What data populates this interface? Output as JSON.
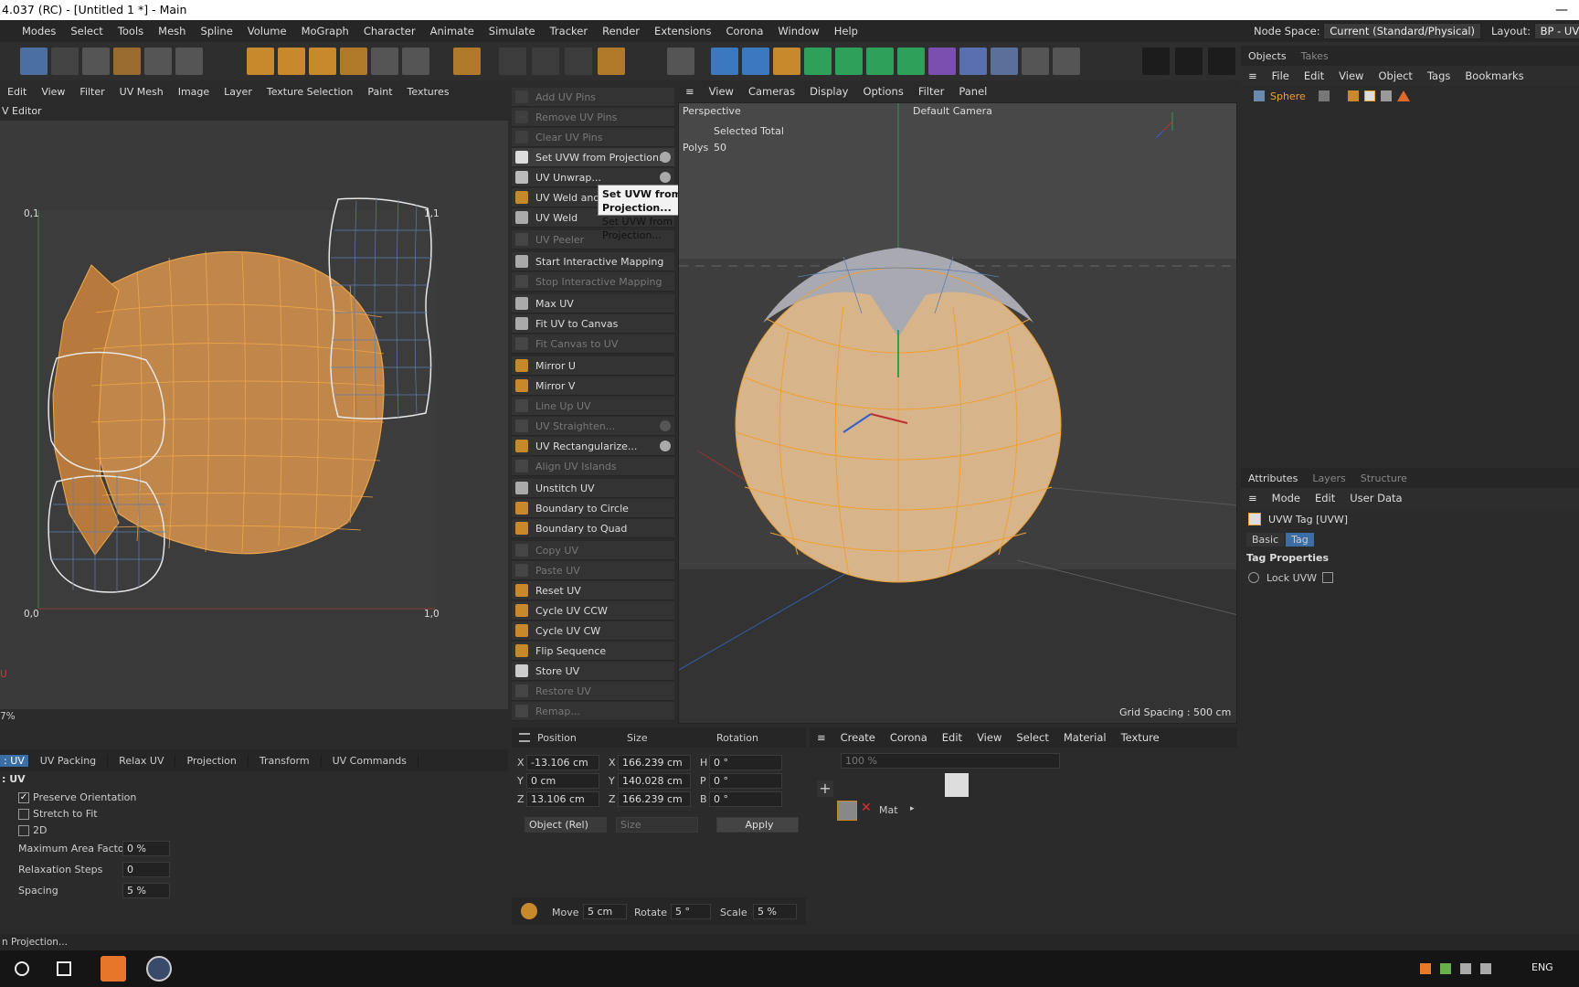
{
  "title": "4.037 (RC) - [Untitled 1 *] - Main",
  "window_min": "—",
  "menu": [
    "Modes",
    "Select",
    "Tools",
    "Mesh",
    "Spline",
    "Volume",
    "MoGraph",
    "Character",
    "Animate",
    "Simulate",
    "Tracker",
    "Render",
    "Extensions",
    "Corona",
    "Window",
    "Help"
  ],
  "node_space": {
    "label": "Node Space:",
    "value": "Current (Standard/Physical)"
  },
  "layout": {
    "label": "Layout:",
    "value": "BP - UV Ed"
  },
  "uv_menu": [
    "Edit",
    "View",
    "Filter",
    "UV Mesh",
    "Image",
    "Layer",
    "Texture Selection",
    "Paint",
    "Textures"
  ],
  "uv_editor_title": "V Editor",
  "uv_labels": {
    "tl": "0,1",
    "tr": "1,1",
    "bl": "0,0",
    "br": "1,0",
    "v": "U"
  },
  "uv_zoom": "7%",
  "commands": [
    {
      "label": "Add UV Pins",
      "enabled": false,
      "icon": "pin-icon"
    },
    {
      "label": "Remove UV Pins",
      "enabled": false,
      "icon": "pin-remove-icon"
    },
    {
      "label": "Clear UV Pins",
      "enabled": false,
      "icon": "pin-clear-icon"
    },
    {
      "label": "Set UVW from Projection...",
      "enabled": true,
      "icon": "checker-icon",
      "gear": true,
      "hover": true
    },
    {
      "label": "UV Unwrap...",
      "enabled": true,
      "icon": "unwrap-icon",
      "gear": true
    },
    {
      "label": "UV Weld and R",
      "enabled": true,
      "icon": "weld-icon"
    },
    {
      "label": "UV Weld",
      "enabled": true,
      "icon": "weld-icon"
    },
    {
      "label": "UV Peeler",
      "enabled": false,
      "icon": "peeler-icon"
    },
    {
      "label": "Start Interactive Mapping",
      "enabled": true,
      "icon": "mapping-start-icon"
    },
    {
      "label": "Stop Interactive Mapping",
      "enabled": false,
      "icon": "mapping-stop-icon"
    },
    {
      "label": "Max UV",
      "enabled": true,
      "icon": "max-uv-icon"
    },
    {
      "label": "Fit UV to Canvas",
      "enabled": true,
      "icon": "fit-uv-icon"
    },
    {
      "label": "Fit Canvas to UV",
      "enabled": false,
      "icon": "fit-canvas-icon"
    },
    {
      "label": "Mirror U",
      "enabled": true,
      "icon": "mirror-u-icon"
    },
    {
      "label": "Mirror V",
      "enabled": true,
      "icon": "mirror-v-icon"
    },
    {
      "label": "Line Up UV",
      "enabled": false,
      "icon": "lineup-icon"
    },
    {
      "label": "UV Straighten...",
      "enabled": false,
      "icon": "straighten-icon",
      "gear": true
    },
    {
      "label": "UV Rectangularize...",
      "enabled": true,
      "icon": "rectangularize-icon",
      "gear": true
    },
    {
      "label": "Align UV Islands",
      "enabled": false,
      "icon": "align-icon"
    },
    {
      "label": "Unstitch UV",
      "enabled": true,
      "icon": "unstitch-icon"
    },
    {
      "label": "Boundary to Circle",
      "enabled": true,
      "icon": "circle-icon"
    },
    {
      "label": "Boundary to Quad",
      "enabled": true,
      "icon": "quad-icon"
    },
    {
      "label": "Copy UV",
      "enabled": false,
      "icon": "copy-icon"
    },
    {
      "label": "Paste UV",
      "enabled": false,
      "icon": "paste-icon"
    },
    {
      "label": "Reset UV",
      "enabled": true,
      "icon": "reset-icon"
    },
    {
      "label": "Cycle UV CCW",
      "enabled": true,
      "icon": "cycle-ccw-icon"
    },
    {
      "label": "Cycle UV CW",
      "enabled": true,
      "icon": "cycle-cw-icon"
    },
    {
      "label": "Flip Sequence",
      "enabled": true,
      "icon": "flip-icon"
    },
    {
      "label": "Store UV",
      "enabled": true,
      "icon": "store-icon"
    },
    {
      "label": "Restore UV",
      "enabled": false,
      "icon": "restore-icon"
    },
    {
      "label": "Remap...",
      "enabled": false,
      "icon": "remap-icon"
    }
  ],
  "tooltip": {
    "title": "Set UVW from Projection...",
    "body": "Set UVW from Projection..."
  },
  "viewport_menu": [
    "View",
    "Cameras",
    "Display",
    "Options",
    "Filter",
    "Panel"
  ],
  "viewport": {
    "name": "Perspective",
    "camera": "Default Camera",
    "sel_header": "Selected Total",
    "polys_label": "Polys",
    "polys_value": "50",
    "grid_spacing": "Grid Spacing : 500 cm"
  },
  "objects": {
    "tabs": [
      "Objects",
      "Takes"
    ],
    "menu": [
      "File",
      "Edit",
      "View",
      "Object",
      "Tags",
      "Bookmarks"
    ],
    "object_name": "Sphere"
  },
  "attributes": {
    "tabs": [
      "Attributes",
      "Layers",
      "Structure"
    ],
    "menu": [
      "Mode",
      "Edit",
      "User Data"
    ],
    "tag_title": "UVW Tag [UVW]",
    "subtabs": [
      "Basic",
      "Tag"
    ],
    "section": "Tag Properties",
    "lock_label": "Lock UVW"
  },
  "uv_bottom": {
    "tabs": [
      ": UV",
      "UV Packing",
      "Relax UV",
      "Projection",
      "Transform",
      "UV Commands"
    ],
    "section": ": UV",
    "preserve": "Preserve Orientation",
    "stretch": "Stretch to Fit",
    "twod": "2D",
    "max_area_label": "Maximum Area Factor",
    "max_area_value": "0 %",
    "relax_label": "Relaxation Steps",
    "relax_value": "0",
    "spacing_label": "Spacing",
    "spacing_value": "5 %"
  },
  "coords": {
    "headers": [
      "Position",
      "Size",
      "Rotation"
    ],
    "rows": [
      {
        "a": "X",
        "pos": "-13.106 cm",
        "b": "X",
        "size": "166.239 cm",
        "c": "H",
        "rot": "0 °"
      },
      {
        "a": "Y",
        "pos": "0 cm",
        "b": "Y",
        "size": "140.028 cm",
        "c": "P",
        "rot": "0 °"
      },
      {
        "a": "Z",
        "pos": "13.106 cm",
        "b": "Z",
        "size": "166.239 cm",
        "c": "B",
        "rot": "0 °"
      }
    ],
    "mode": "Object (Rel)",
    "size_mode": "Size",
    "apply": "Apply",
    "move_label": "Move",
    "move_value": "5 cm",
    "rotate_label": "Rotate",
    "rotate_value": "5 °",
    "scale_label": "Scale",
    "scale_value": "5 %"
  },
  "material": {
    "menu": [
      "Create",
      "Corona",
      "Edit",
      "View",
      "Select",
      "Material",
      "Texture"
    ],
    "zoom": "100 %",
    "mat_name": "Mat"
  },
  "status": "n Projection...",
  "tray": {
    "lang": "ENG"
  },
  "colors": {
    "accent": "#f0a030",
    "uv_island": "#c98b4a",
    "uv_wire": "#f3a94a",
    "sphere": "#d8b48a",
    "selected_tab": "#3b6ea5"
  }
}
